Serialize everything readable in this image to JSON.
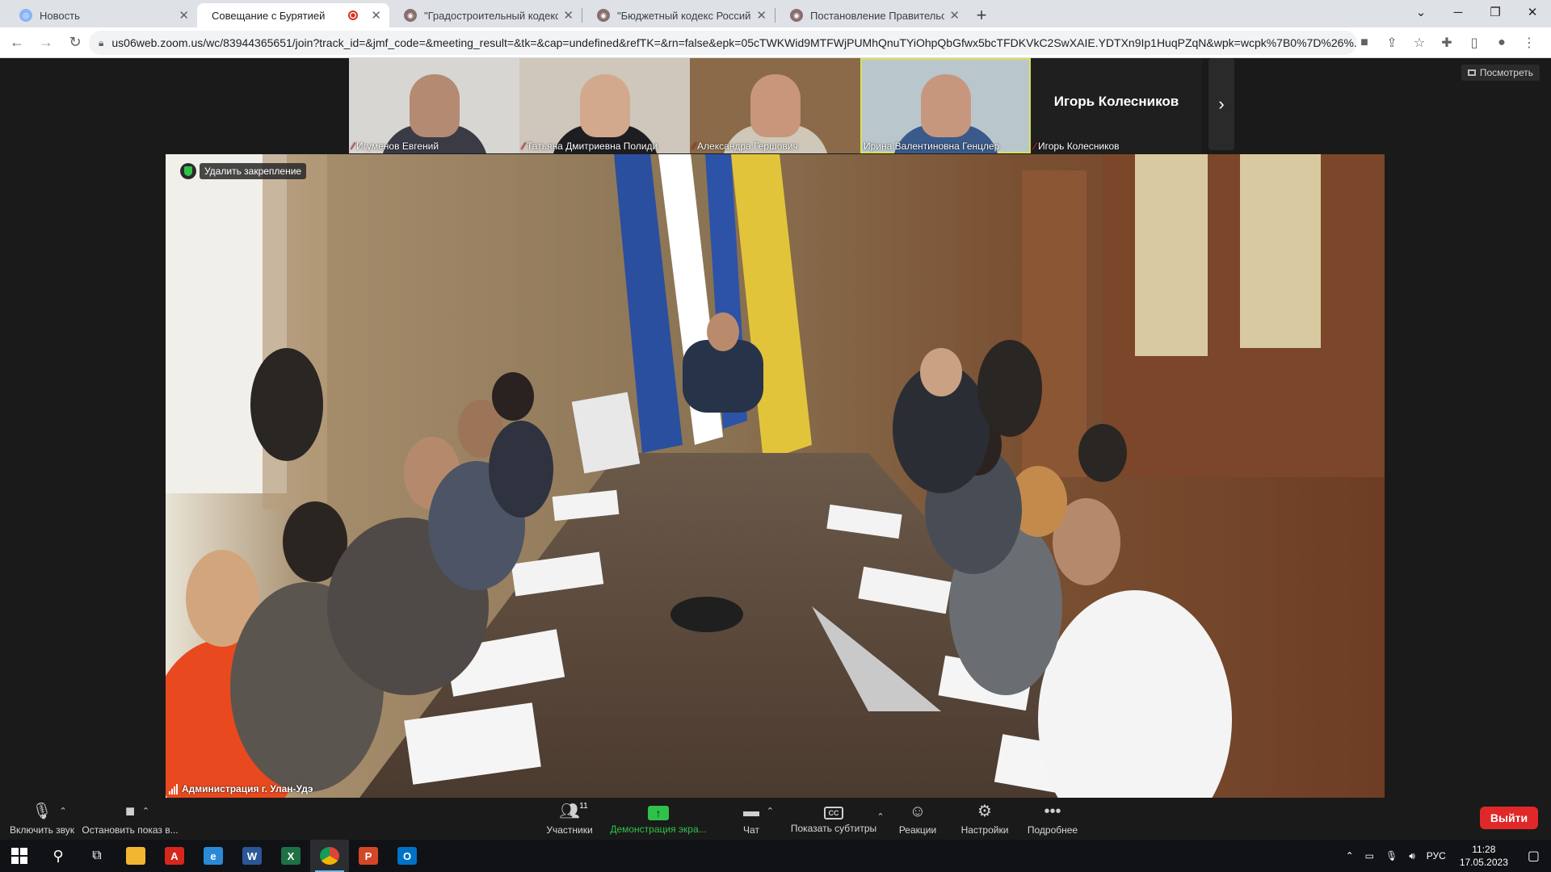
{
  "browser": {
    "tabs": [
      {
        "title": "Новость",
        "favicon": "news-icon"
      },
      {
        "title": "Совещание с Бурятией",
        "favicon": "zoom-icon",
        "active": true,
        "recording": true
      },
      {
        "title": "\"Градостроительный кодекс Ро",
        "favicon": "document-icon"
      },
      {
        "title": "\"Бюджетный кодекс Российско",
        "favicon": "document-icon"
      },
      {
        "title": "Постановление Правительства",
        "favicon": "document-icon"
      }
    ],
    "url": "us06web.zoom.us/wc/83944365651/join?track_id=&jmf_code=&meeting_result=&tk=&cap=undefined&refTK=&rn=false&epk=05cTWKWid9MTFWjPUMhQnuTYiOhpQbGfwx5bcTFDKVkC2SwXAIE.YDTXn9Ip1HuqPZqN&wpk=wcpk%7B0%7D%26%..."
  },
  "zoom": {
    "view_button": "Посмотреть",
    "participants": [
      {
        "name": "Игуменов Евгений",
        "muted": true,
        "bg": "#d8d6d2",
        "skin": "#b48a72",
        "shirt": "#3a3b45"
      },
      {
        "name": "Татьяна Дмитриевна Полиди",
        "muted": true,
        "bg": "#cfc7bc",
        "skin": "#d3a98e",
        "shirt": "#1e1e22"
      },
      {
        "name": "Александра Гершович",
        "muted": true,
        "bg": "#8a6a48",
        "skin": "#c8967a",
        "shirt": "#cfc7b8"
      },
      {
        "name": "Ирина Валентиновна Генцлер",
        "muted": false,
        "speaking": true,
        "bg": "#b9c7cc",
        "skin": "#c7977d",
        "shirt": "#3a5a8c"
      }
    ],
    "no_video_participant": {
      "name": "Игорь Колесников",
      "muted": true
    },
    "unpin_label": "Удалить закрепление",
    "main_speaker": "Администрация г. Улан-Удэ",
    "controls": {
      "unmute": "Включить звук",
      "stop_video": "Остановить показ в...",
      "participants": "Участники",
      "participants_count": "11",
      "share_screen": "Демонстрация экра...",
      "chat": "Чат",
      "captions": "Показать субтитры",
      "captions_icon": "CC",
      "reactions": "Реакции",
      "settings": "Настройки",
      "more": "Подробнее",
      "leave": "Выйти"
    }
  },
  "taskbar": {
    "apps": [
      {
        "name": "file-explorer-icon",
        "color": "#f2b631"
      },
      {
        "name": "acrobat-icon",
        "color": "#d7261e",
        "letter": "A"
      },
      {
        "name": "edge-icon",
        "color": "#2b8ad8",
        "letter": "e"
      },
      {
        "name": "word-icon",
        "color": "#2b5797",
        "letter": "W"
      },
      {
        "name": "excel-icon",
        "color": "#1e7145",
        "letter": "X"
      },
      {
        "name": "chrome-icon",
        "color": "#e8b21a",
        "letter": "",
        "active": true
      },
      {
        "name": "powerpoint-icon",
        "color": "#d24726",
        "letter": "P"
      },
      {
        "name": "outlook-icon",
        "color": "#0072c6",
        "letter": "O"
      }
    ],
    "language": "РУС",
    "time": "11:28",
    "date": "17.05.2023"
  }
}
